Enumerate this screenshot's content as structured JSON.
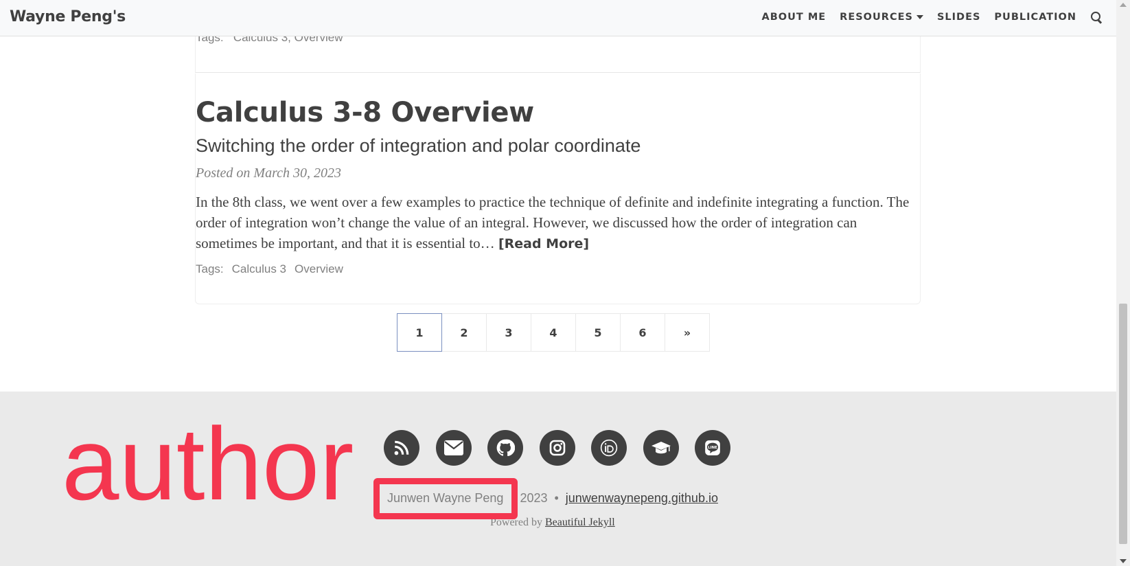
{
  "navbar": {
    "brand": "Wayne Peng's",
    "items": [
      {
        "label": "ABOUT ME"
      },
      {
        "label": "RESOURCES"
      },
      {
        "label": "SLIDES"
      },
      {
        "label": "PUBLICATION"
      }
    ],
    "search_icon": "search-icon"
  },
  "prev_post": {
    "tags_label": "Tags:",
    "tags_text": "Calculus 3,   Overview"
  },
  "post": {
    "title": "Calculus 3-8 Overview",
    "subtitle": "Switching the order of integration and polar coordinate",
    "meta": "Posted on March 30, 2023",
    "excerpt": "In the 8th class, we went over a few examples to practice the technique of definite and indefinite integrating a function. The order of integration won’t change the value of an integral. However, we discussed how the order of integration can sometimes be important, and that it is essential to…",
    "read_more": "[Read More]",
    "tags_label": "Tags:",
    "tags": [
      "Calculus 3",
      "Overview"
    ]
  },
  "pagination": {
    "pages": [
      "1",
      "2",
      "3",
      "4",
      "5",
      "6",
      "»"
    ],
    "active": "1"
  },
  "footer": {
    "social_icons": [
      "rss-icon",
      "email-icon",
      "github-icon",
      "instagram-icon",
      "orcid-icon",
      "graduation-cap-icon",
      "line-icon"
    ],
    "author": "Junwen Wayne Peng",
    "year": "2023",
    "separator": "•",
    "site": "junwenwaynepeng.github.io",
    "powered_by": "Powered by",
    "powered_link": "Beautiful Jekyll"
  },
  "annotation": {
    "word": "author",
    "color": "#f4364f"
  }
}
